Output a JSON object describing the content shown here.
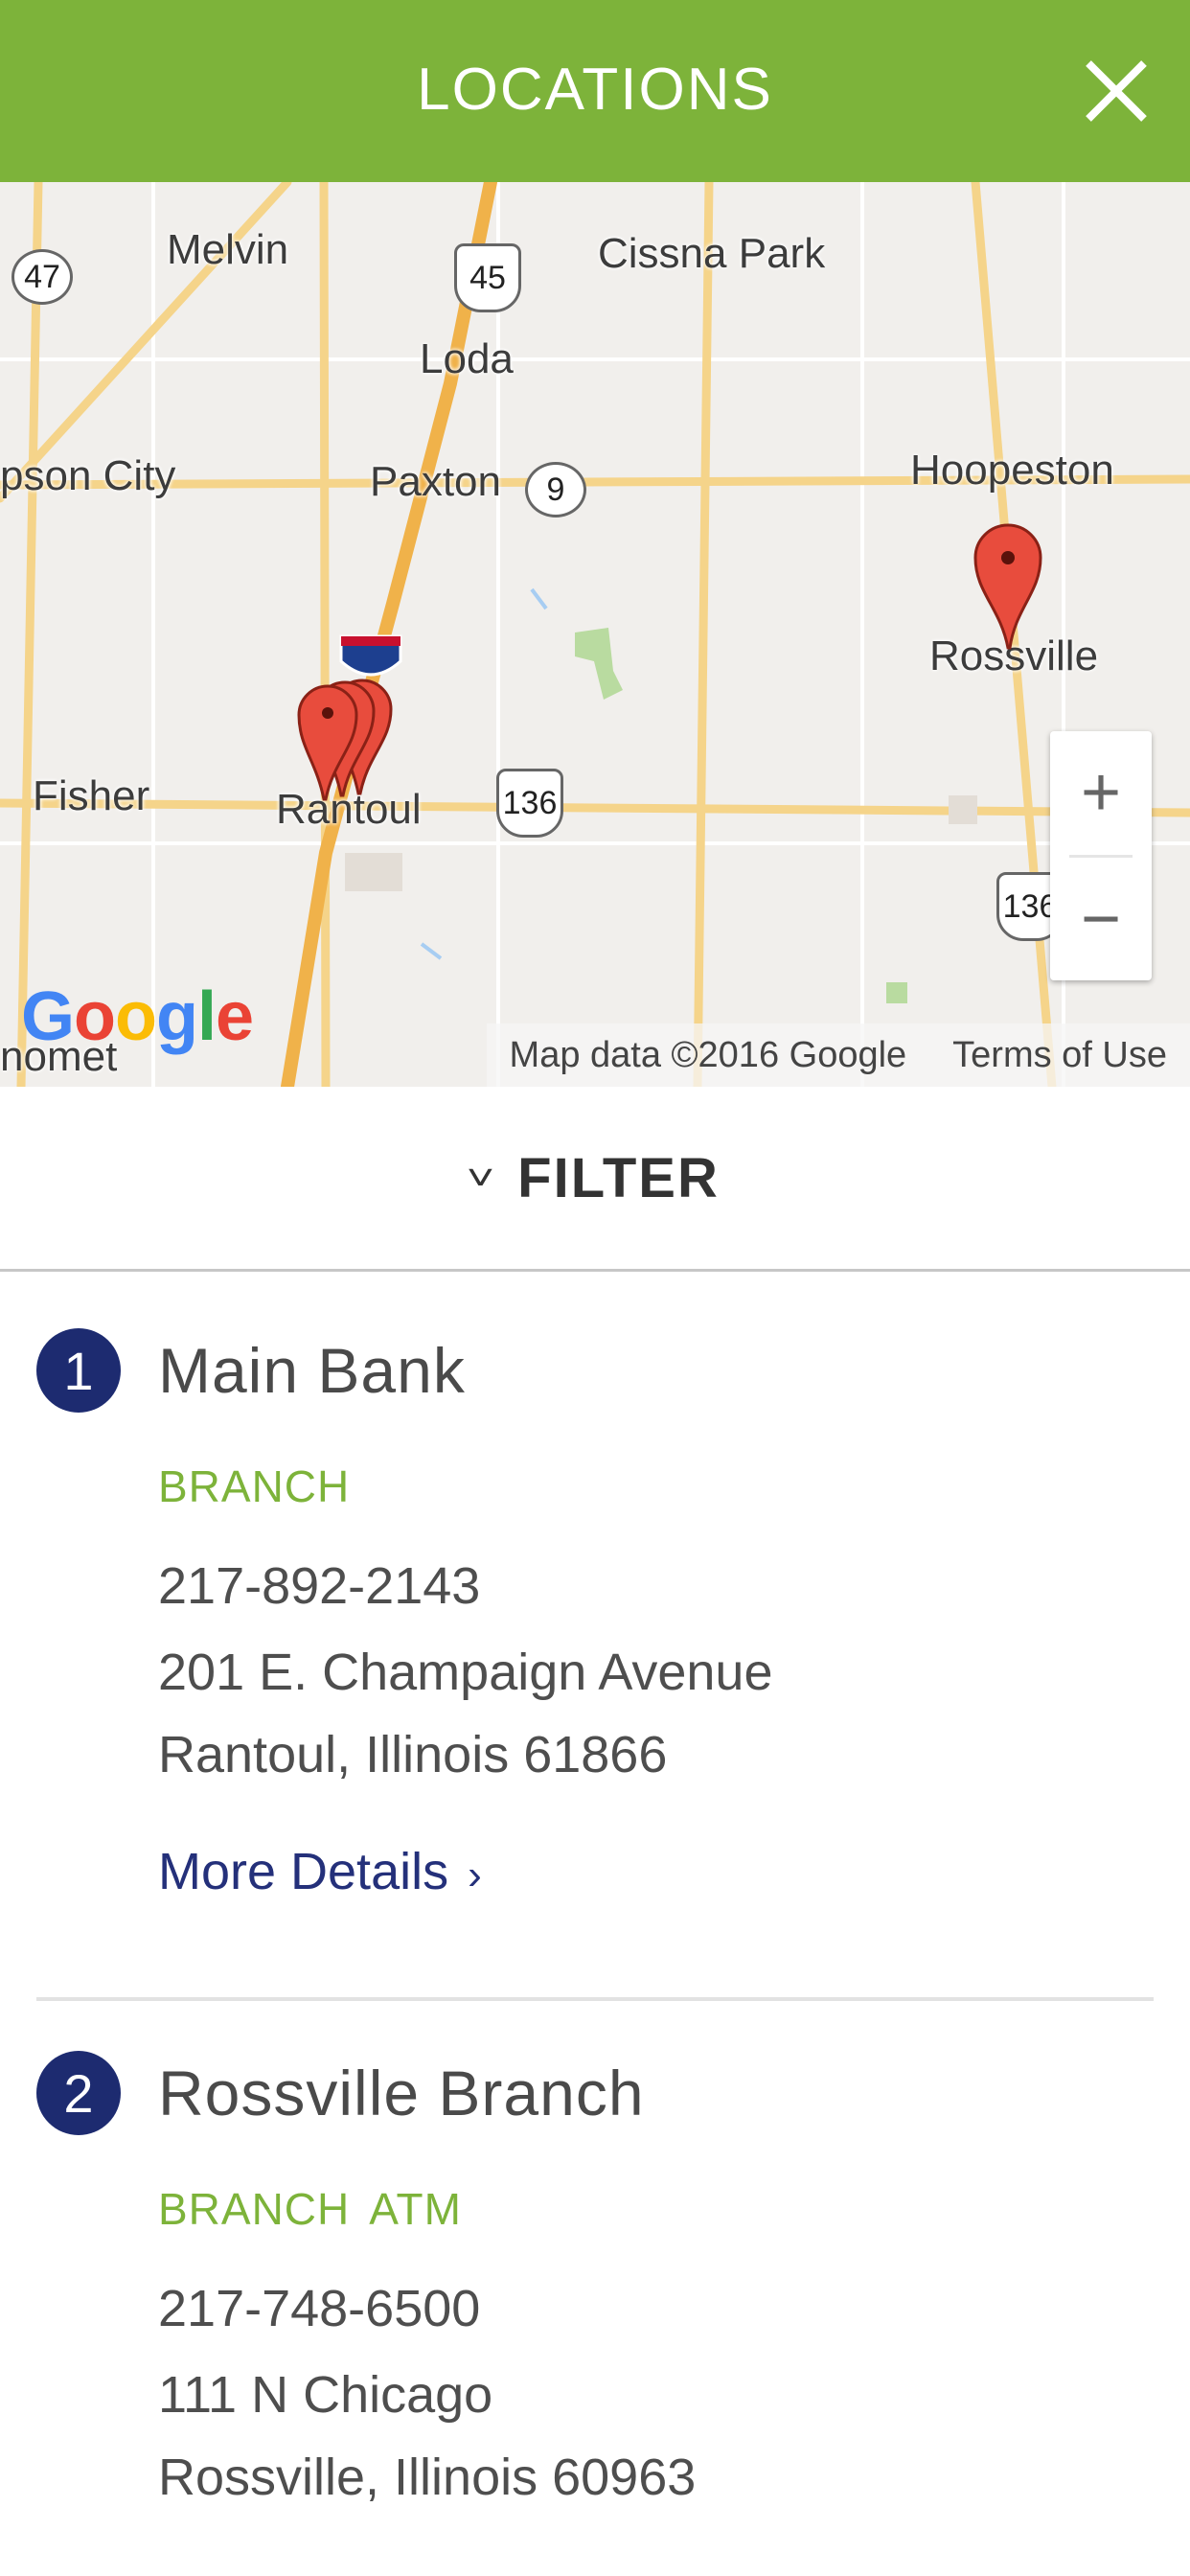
{
  "header": {
    "title": "LOCATIONS",
    "close_icon": "close-icon"
  },
  "map": {
    "places": [
      "Melvin",
      "Cissna Park",
      "Loda",
      "Paxton",
      "Hoopeston",
      "Rossville",
      "Fisher",
      "Rantoul"
    ],
    "edge_places": [
      "pson City",
      "nomet"
    ],
    "routes": {
      "r47": "47",
      "r45": "45",
      "r9": "9",
      "r136a": "136",
      "r136b": "136"
    },
    "zoom": {
      "in_label": "+",
      "out_label": "−"
    },
    "google_logo": [
      "G",
      "o",
      "o",
      "g",
      "l",
      "e"
    ],
    "attribution": "Map data ©2016 Google",
    "terms": "Terms of Use"
  },
  "filter": {
    "label": "FILTER"
  },
  "locations": [
    {
      "number": "1",
      "name": "Main Bank",
      "tags": [
        "BRANCH"
      ],
      "phone": "217-892-2143",
      "address1": "201 E. Champaign Avenue",
      "address2": "Rantoul, Illinois 61866",
      "details_label": "More Details",
      "details_chevron": "›"
    },
    {
      "number": "2",
      "name": "Rossville Branch",
      "tags": [
        "BRANCH",
        "ATM"
      ],
      "phone": "217-748-6500",
      "address1": "111 N Chicago",
      "address2": "Rossville, Illinois 60963"
    }
  ],
  "colors": {
    "header": "#7db33a",
    "accent_blue": "#1d2b70",
    "tag_green": "#7db33a",
    "marker": "#e84c3d"
  }
}
